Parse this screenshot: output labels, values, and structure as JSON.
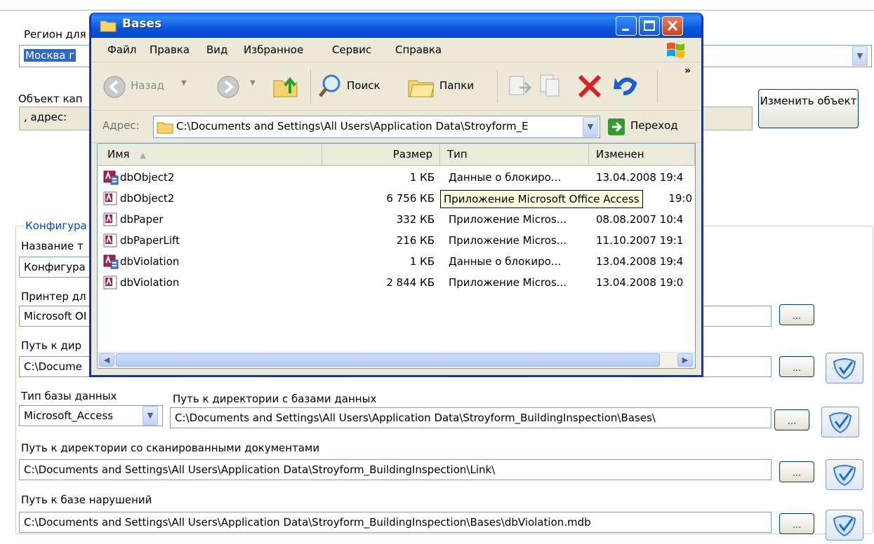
{
  "background_form": {
    "top_partial_text": "",
    "region_label": "Регион для",
    "region_value": "Москва г",
    "object_label": "Объект кап",
    "object_value": ", адрес:",
    "change_object_button": "Изменить объект",
    "config_group_label": "Конфигура",
    "config_name_label": "Название т",
    "config_name_value": "Конфигура",
    "printer_label": "Принтер дл",
    "printer_value": "Microsoft OI",
    "path_dir_label": "Путь к дир",
    "path_dir_value": "C:\\Docume",
    "db_type_label": "Тип базы данных",
    "db_type_value": "Microsoft_Access",
    "db_dir_label": "Путь к директории с базами данных",
    "db_dir_value": "C:\\Documents and Settings\\All Users\\Application Data\\Stroyform_BuildingInspection\\Bases\\",
    "scan_dir_label": "Путь к директории со сканированными документами",
    "scan_dir_value": "C:\\Documents and Settings\\All Users\\Application Data\\Stroyform_BuildingInspection\\Link\\",
    "violations_label": "Путь к базе нарушений",
    "violations_value": "C:\\Documents and Settings\\All Users\\Application Data\\Stroyform_BuildingInspection\\Bases\\dbViolation.mdb",
    "browse_label": "..."
  },
  "window": {
    "title": "Bases",
    "menu": [
      "Файл",
      "Правка",
      "Вид",
      "Избранное",
      "Сервис",
      "Справка"
    ],
    "toolbar": {
      "back": "Назад",
      "search": "Поиск",
      "folders": "Папки",
      "more": "»"
    },
    "address_label": "Адрес:",
    "address_value": "C:\\Documents and Settings\\All Users\\Application Data\\Stroyform_E",
    "go_label": "Переход",
    "columns": [
      "Имя",
      "Размер",
      "Тип",
      "Изменен"
    ],
    "files": [
      {
        "name": "dbObject2",
        "size": "1 КБ",
        "type": "Данные о блокиро...",
        "modified": "13.04.2008 19:4",
        "icon": "ldb-icon"
      },
      {
        "name": "dbObject2",
        "size": "6 756 КБ",
        "type": "",
        "modified": "19:0",
        "icon": "mdb-icon"
      },
      {
        "name": "dbPaper",
        "size": "332 КБ",
        "type": "Приложение Micros...",
        "modified": "08.08.2007 10:4",
        "icon": "mdb-icon"
      },
      {
        "name": "dbPaperLift",
        "size": "216 КБ",
        "type": "Приложение Micros...",
        "modified": "11.10.2007 19:1",
        "icon": "mdb-icon"
      },
      {
        "name": "dbViolation",
        "size": "1 КБ",
        "type": "Данные о блокиро...",
        "modified": "13.04.2008 19:4",
        "icon": "ldb-icon"
      },
      {
        "name": "dbViolation",
        "size": "2 844 КБ",
        "type": "Приложение Micros...",
        "modified": "13.04.2008 19:0",
        "icon": "mdb-icon"
      }
    ],
    "tooltip": "Приложение Microsoft Office Access"
  },
  "colors": {
    "xp_blue": "#0a58e6",
    "selection": "#316ac5"
  }
}
